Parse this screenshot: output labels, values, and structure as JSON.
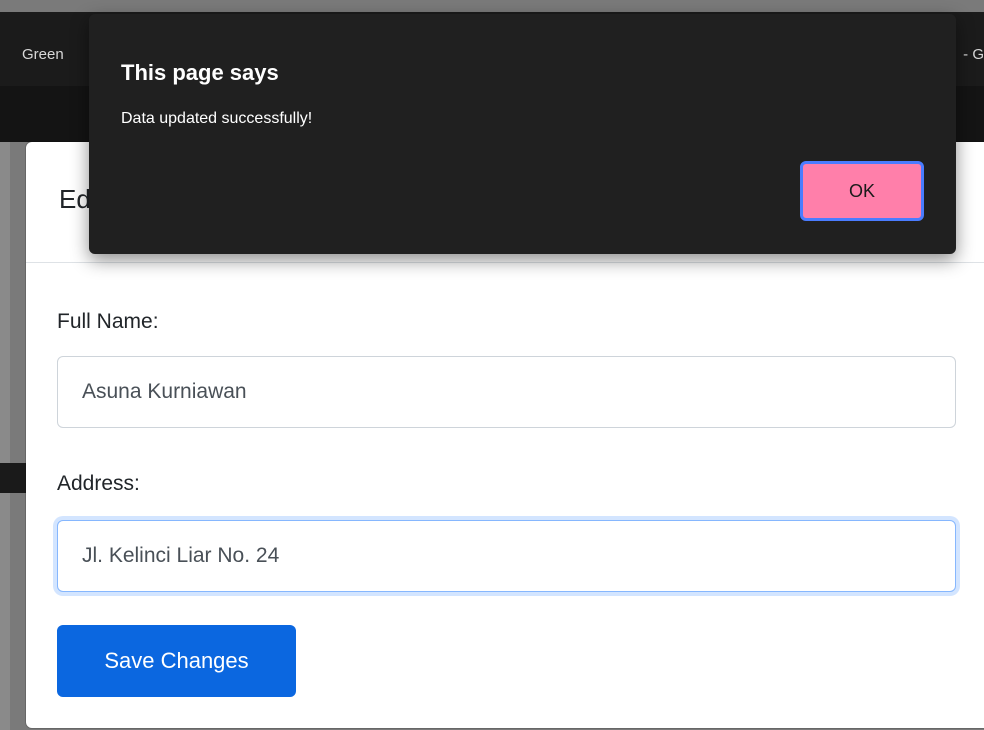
{
  "background": {
    "topbar_left_text": "Green",
    "topbar_right_text": "- G"
  },
  "modal": {
    "title_partial": "Ed",
    "full_name_label": "Full Name:",
    "full_name_value": "Asuna Kurniawan",
    "address_label": "Address:",
    "address_value": "Jl. Kelinci Liar No. 24",
    "save_label": "Save Changes"
  },
  "alert": {
    "title": "This page says",
    "message": "Data updated successfully!",
    "ok_label": "OK"
  },
  "colors": {
    "save_button": "#0b67e0",
    "ok_button": "#ff7faa",
    "alert_bg": "#202020"
  }
}
